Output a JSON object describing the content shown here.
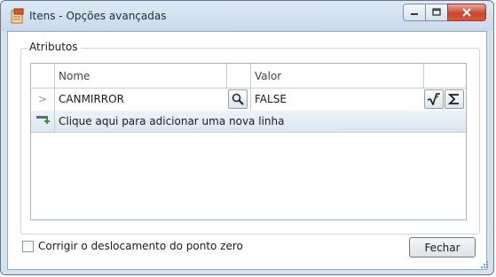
{
  "window": {
    "title": "Itens - Opções avançadas",
    "controls": [
      "minimize-icon",
      "maximize-icon",
      "close-icon"
    ]
  },
  "group": {
    "title": "Atributos"
  },
  "grid": {
    "columns": [
      "Nome",
      "Valor"
    ],
    "rows": [
      {
        "selector": ">",
        "name": "CANMIRROR",
        "value": "FALSE"
      }
    ],
    "new_row_label": "Clique aqui para adicionar uma nova linha"
  },
  "checkbox": {
    "label": "Corrigir o deslocamento do ponto zero",
    "checked": false
  },
  "buttons": {
    "close_label": "Fechar"
  },
  "colors": {
    "titlebar": "#c9d9ec",
    "close_button": "#c8452f",
    "grid_border": "#a9b3bd"
  }
}
